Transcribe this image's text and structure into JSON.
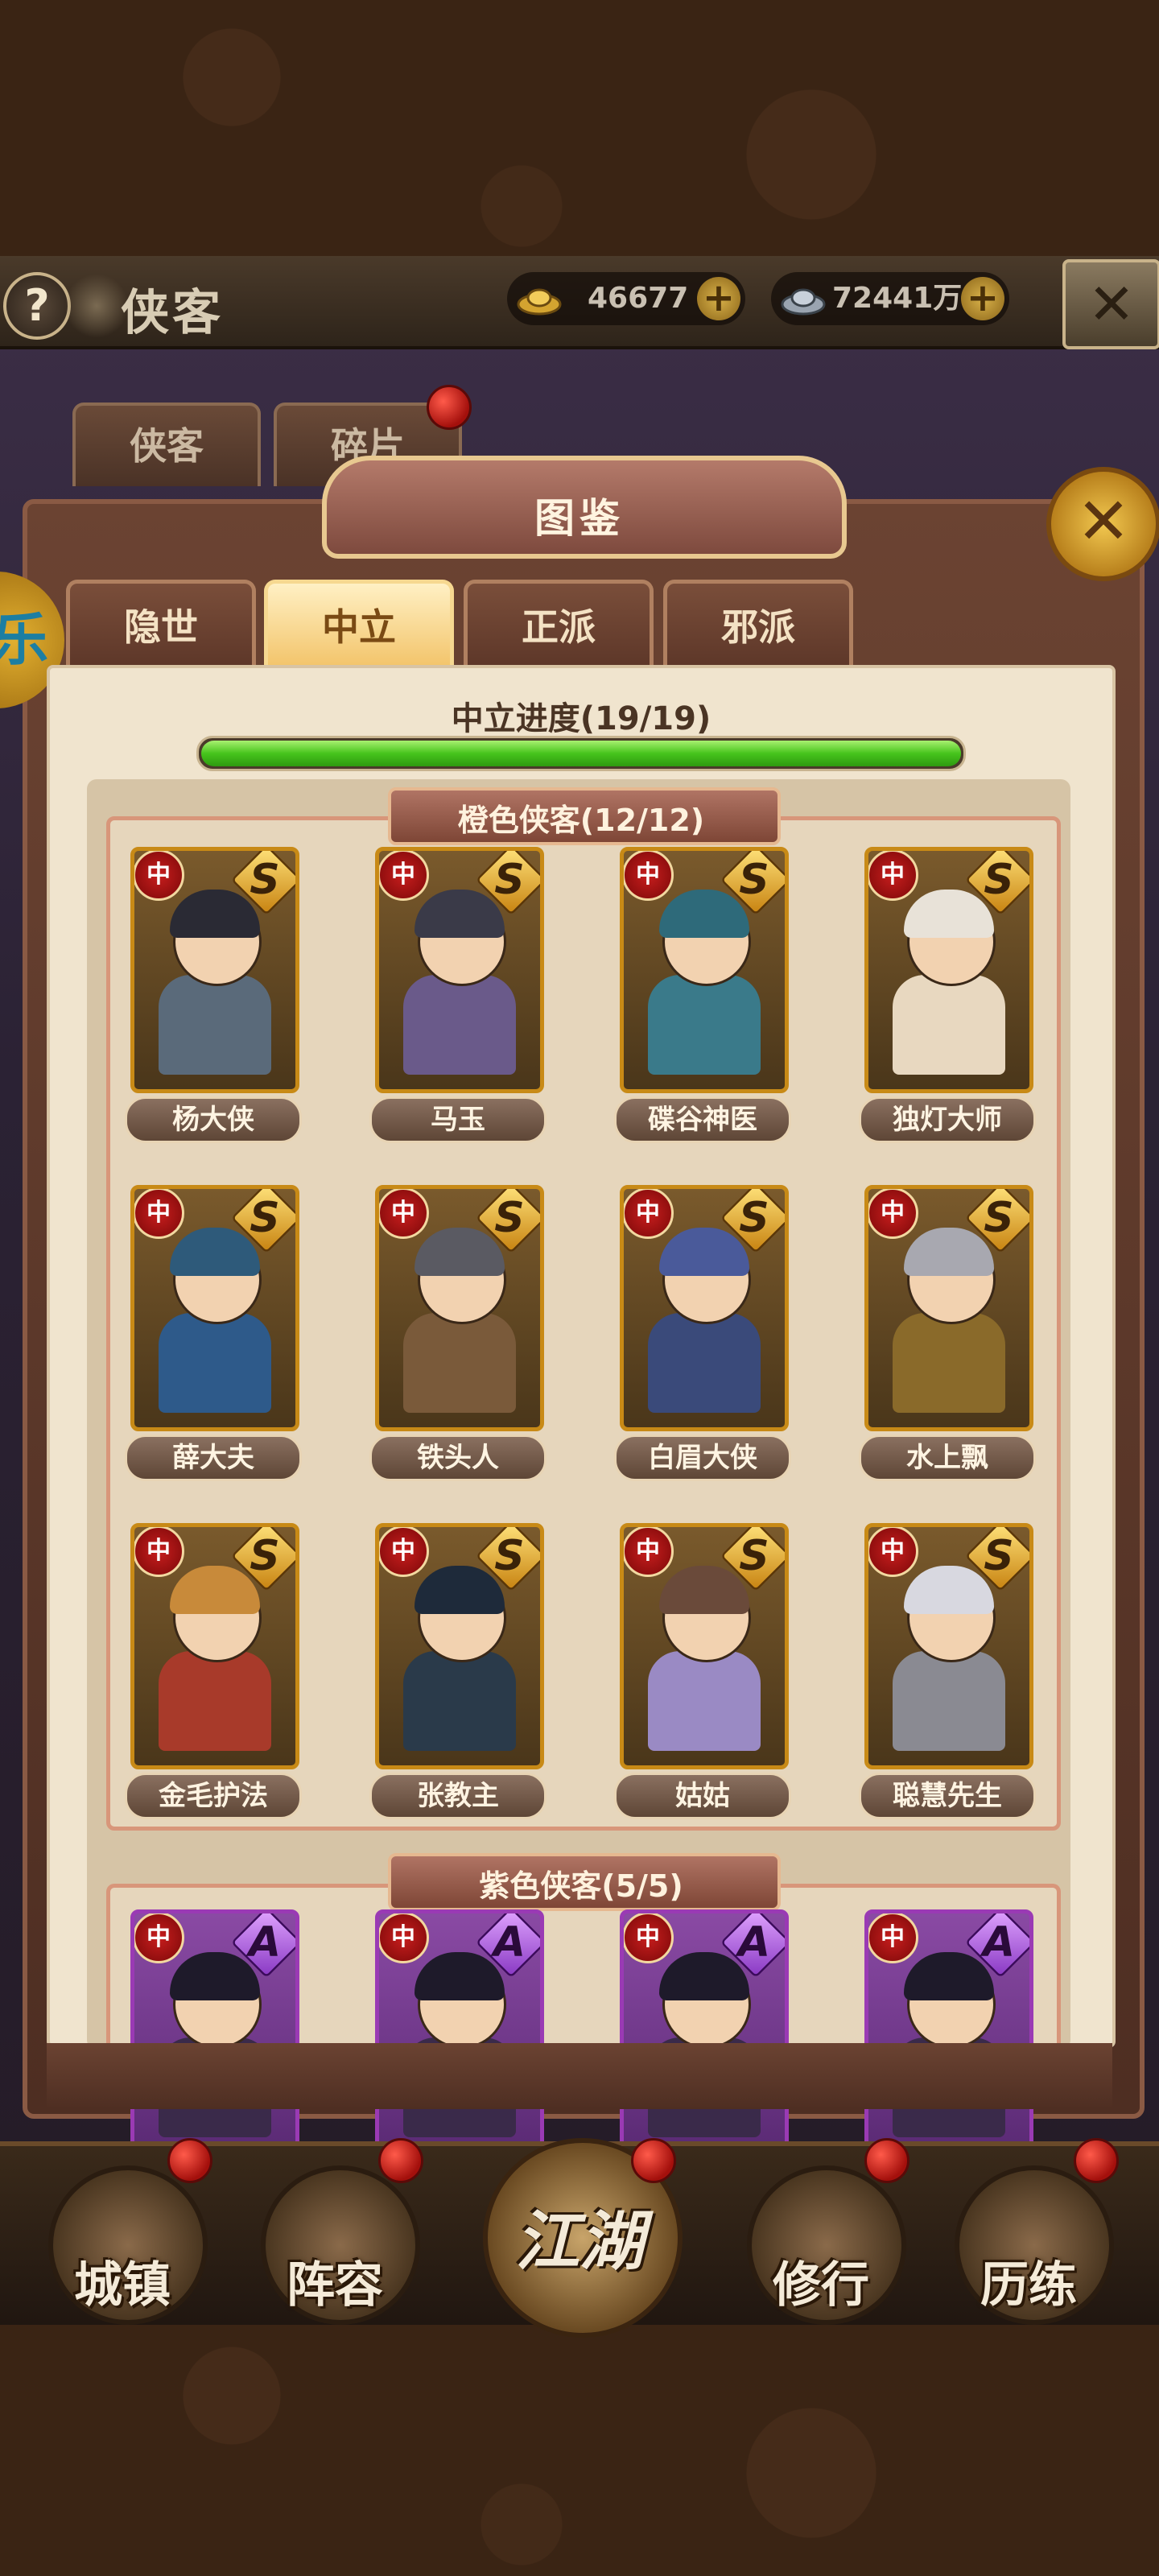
{
  "header": {
    "help_icon": "question-mark-icon",
    "title": "侠客",
    "gold": "46677",
    "silver": "72441万",
    "close_icon": "x-icon"
  },
  "upper_tabs": [
    "侠客",
    "碎片"
  ],
  "panel": {
    "title": "图鉴",
    "side_badge": "乐",
    "faction_tabs": [
      "隐世",
      "中立",
      "正派",
      "邪派"
    ],
    "active_faction": "中立",
    "progress_label": "中立进度(19/19)",
    "progress": 1.0
  },
  "sections": [
    {
      "title": "橙色侠客(12/12)",
      "grade": "S",
      "faction_mark": "中",
      "heroes": [
        {
          "name": "杨大侠"
        },
        {
          "name": "马玉"
        },
        {
          "name": "碟谷神医"
        },
        {
          "name": "独灯大师"
        },
        {
          "name": "薛大夫"
        },
        {
          "name": "铁头人"
        },
        {
          "name": "白眉大侠"
        },
        {
          "name": "水上飘"
        },
        {
          "name": "金毛护法"
        },
        {
          "name": "张教主"
        },
        {
          "name": "姑姑"
        },
        {
          "name": "聪慧先生"
        }
      ]
    },
    {
      "title": "紫色侠客(5/5)",
      "grade": "A",
      "faction_mark": "中",
      "heroes": [
        {
          "name": ""
        },
        {
          "name": ""
        },
        {
          "name": ""
        },
        {
          "name": ""
        }
      ]
    }
  ],
  "bottom_nav": [
    "城镇",
    "阵容",
    "江湖",
    "修行",
    "历练"
  ],
  "colors": {
    "orange_border": "#c88a16",
    "purple_border": "#9a3ab4",
    "progress_green": "#46c41c",
    "active_tab": "#f2c266"
  }
}
